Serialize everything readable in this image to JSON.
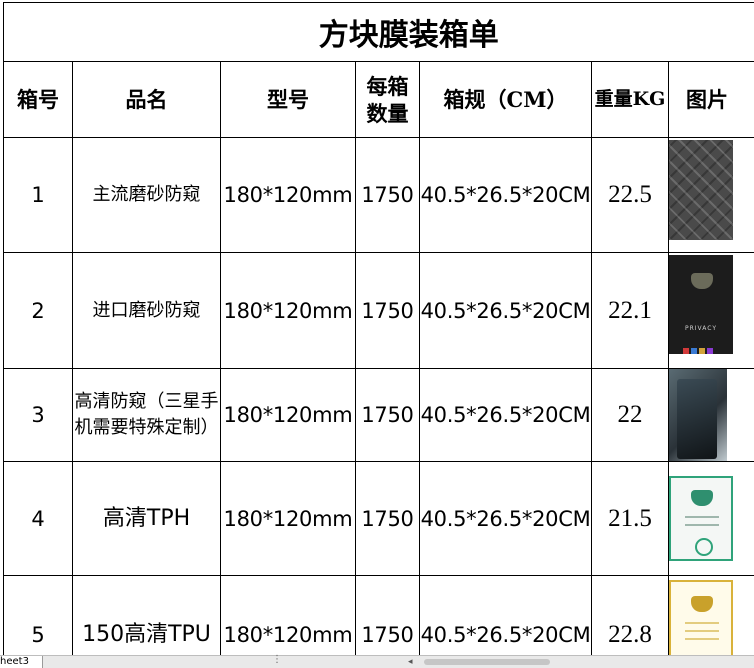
{
  "title": "方块膜装箱单",
  "headers": {
    "box_no": "箱号",
    "product_name": "品名",
    "model": "型号",
    "qty_line1": "每箱",
    "qty_line2": "数量",
    "box_spec": "箱规（CM）",
    "weight": "重量KG",
    "picture": "图片"
  },
  "rows": [
    {
      "box_no": "1",
      "product_name": "主流磨砂防窥",
      "model": "180*120mm",
      "qty": "1750",
      "box_spec": "40.5*26.5*20CM",
      "weight": "22.5"
    },
    {
      "box_no": "2",
      "product_name": "进口磨砂防窥",
      "model": "180*120mm",
      "qty": "1750",
      "box_spec": "40.5*26.5*20CM",
      "weight": "22.1"
    },
    {
      "box_no": "3",
      "product_name": "高清防窥（三星手机需要特殊定制）",
      "model": "180*120mm",
      "qty": "1750",
      "box_spec": "40.5*26.5*20CM",
      "weight": "22"
    },
    {
      "box_no": "4",
      "product_name": "高清TPH",
      "model": "180*120mm",
      "qty": "1750",
      "box_spec": "40.5*26.5*20CM",
      "weight": "21.5"
    },
    {
      "box_no": "5",
      "product_name": "150高清TPU",
      "model": "180*120mm",
      "qty": "1750",
      "box_spec": "40.5*26.5*20CM",
      "weight": "22.8"
    }
  ],
  "thumb_text": {
    "row2": "PRIVACY"
  },
  "sheet_tab": {
    "label": "heet3"
  },
  "colors": {
    "border": "#000000",
    "tab_bar": "#e9e9e9",
    "scroll_thumb": "#c6c6c6",
    "green_accent": "#2fa37a",
    "gold_accent": "#d9b23a"
  },
  "icons": {
    "tab_overflow": "ellipsis-icon",
    "scroll_left": "scroll-left-arrow-icon"
  }
}
